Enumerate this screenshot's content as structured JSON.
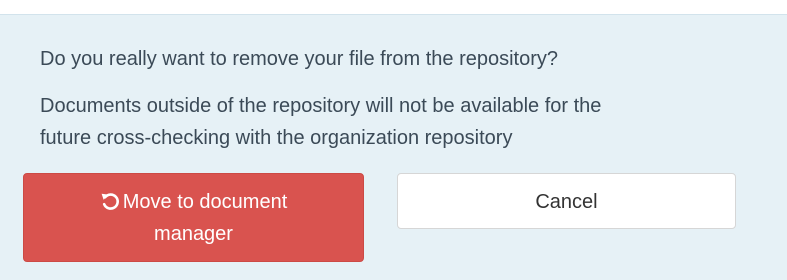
{
  "dialog": {
    "question": "Do you really want to remove your file from the repository?",
    "note_line1": "Documents outside of the repository will not be available for the",
    "note_line2": "future cross-checking with the organization repository"
  },
  "buttons": {
    "move_label_line1": "Move to document",
    "move_label_line2": "manager",
    "move_icon": "undo-icon",
    "cancel_label": "Cancel"
  },
  "colors": {
    "panel_bg": "#e6f1f6",
    "danger": "#d9534f",
    "text": "#3b4a57"
  }
}
